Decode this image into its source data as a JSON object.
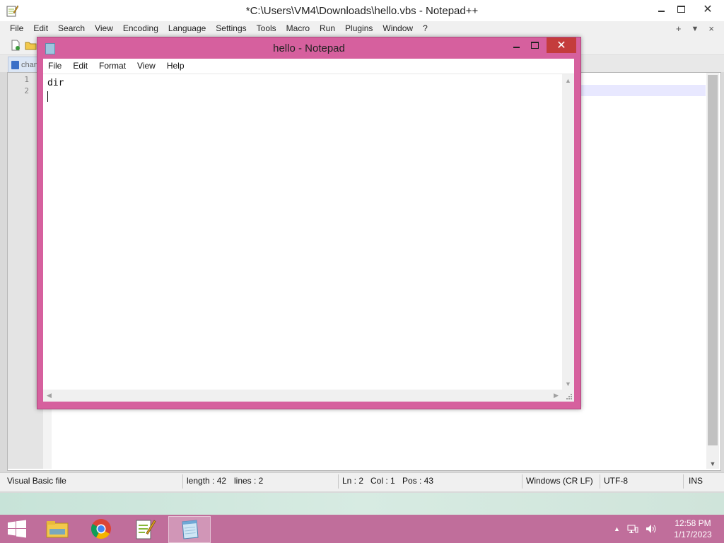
{
  "npp": {
    "title": "*C:\\Users\\VM4\\Downloads\\hello.vbs - Notepad++",
    "menu": [
      "File",
      "Edit",
      "Search",
      "View",
      "Encoding",
      "Language",
      "Settings",
      "Tools",
      "Macro",
      "Run",
      "Plugins",
      "Window",
      "?"
    ],
    "menu_right": [
      "+",
      "▼",
      "×"
    ],
    "tab_label": "chan",
    "line_numbers": [
      "1",
      "2"
    ],
    "status": {
      "file_type": "Visual Basic file",
      "length": "length : 42",
      "lines": "lines : 2",
      "ln": "Ln : 2",
      "col": "Col : 1",
      "pos": "Pos : 43",
      "eol": "Windows (CR LF)",
      "encoding": "UTF-8",
      "mode": "INS"
    }
  },
  "notepad": {
    "title": "hello - Notepad",
    "menu": [
      "File",
      "Edit",
      "Format",
      "View",
      "Help"
    ],
    "content": "dir"
  },
  "taskbar": {
    "apps": [
      "file-explorer-icon",
      "chrome-icon",
      "notepad-plus-plus-icon",
      "notepad-icon"
    ],
    "active_app": "notepad-icon",
    "time": "12:58 PM",
    "date": "1/17/2023"
  },
  "colors": {
    "accent": "#d6609e",
    "taskbar": "#c06e9b",
    "close_button": "#c43c3c"
  }
}
